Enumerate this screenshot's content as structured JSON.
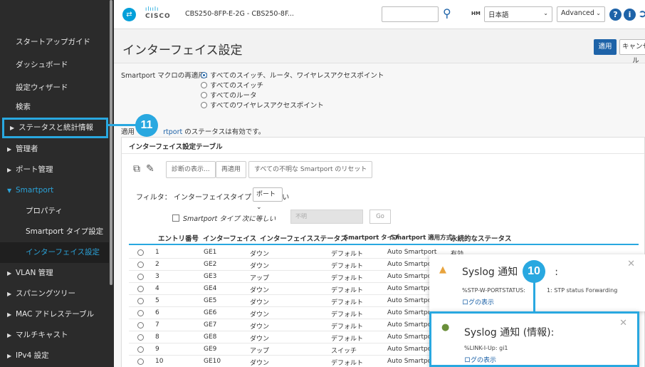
{
  "header": {
    "home_icon": "home-icon",
    "brand_lines": "ılıılı",
    "brand_word": "CISCO",
    "device": "CBS250-8FP-E-2G - CBS250-8F...",
    "hm_label": "HM",
    "language": "日本語",
    "mode": "Advanced"
  },
  "sidebar": {
    "items": [
      {
        "label": "スタートアップガイド"
      },
      {
        "label": "ダッシュボード"
      },
      {
        "label": "設定ウィザード"
      },
      {
        "label": "検索"
      },
      {
        "label": "ステータスと統計情報"
      },
      {
        "label": "管理者"
      },
      {
        "label": "ポート管理"
      },
      {
        "label": "Smartport"
      },
      {
        "label": "プロパティ"
      },
      {
        "label": "Smartport タイプ設定"
      },
      {
        "label": "インターフェイス設定"
      },
      {
        "label": "VLAN 管理"
      },
      {
        "label": "スパニングツリー"
      },
      {
        "label": "MAC アドレステーブル"
      },
      {
        "label": "マルチキャスト"
      },
      {
        "label": "IPv4 設定"
      }
    ]
  },
  "title_bar": {
    "title": "インターフェイス設定",
    "apply": "適用",
    "cancel": "キャンセル"
  },
  "reapply": {
    "label": "Smartport マクロの再適用：",
    "options": [
      "すべてのスイッチ、ルータ、ワイヤレスアクセスポイント",
      "すべてのスイッチ",
      "すべてのルータ",
      "すべてのワイヤレスアクセスポイント"
    ]
  },
  "status": {
    "prefix": "適用",
    "link": "rtport",
    "suffix": " のステータスは有効です。"
  },
  "panel": {
    "title": "インターフェイス設定テーブル",
    "diag": "診断の表示...",
    "reapply": "再適用",
    "reset": "すべての不明な Smartport のリセット",
    "filter_label": "フィルタ：  インターフェイスタイプ  次に等しい",
    "filter_value": "ポート",
    "checkbox_label": "Smartport タイプ  次に等しい",
    "disabled_value": "不明",
    "go": "Go"
  },
  "table": {
    "headers": [
      "エントリ番号",
      "インターフェイス",
      "インターフェイスステータス",
      "Smartport タイプ",
      "Smartport 適用方式",
      "永続的なステータス"
    ],
    "rows": [
      [
        "1",
        "GE1",
        "ダウン",
        "デフォルト",
        "Auto Smartport",
        "有効"
      ],
      [
        "2",
        "GE2",
        "ダウン",
        "デフォルト",
        "Auto Smartpor",
        ""
      ],
      [
        "3",
        "GE3",
        "アップ",
        "デフォルト",
        "Auto Smartpor",
        ""
      ],
      [
        "4",
        "GE4",
        "ダウン",
        "デフォルト",
        "Auto Smartpor",
        ""
      ],
      [
        "5",
        "GE5",
        "ダウン",
        "デフォルト",
        "Auto Smartpor",
        ""
      ],
      [
        "6",
        "GE6",
        "ダウン",
        "デフォルト",
        "Auto Smartpo",
        ""
      ],
      [
        "7",
        "GE7",
        "ダウン",
        "デフォルト",
        "Auto Smartpo",
        ""
      ],
      [
        "8",
        "GE8",
        "ダウン",
        "デフォルト",
        "Auto Smartpo",
        ""
      ],
      [
        "9",
        "GE9",
        "アップ",
        "スイッチ",
        "Auto Smartpo",
        ""
      ],
      [
        "10",
        "GE10",
        "ダウン",
        "デフォルト",
        "Auto Smartpo",
        ""
      ]
    ]
  },
  "notifications": {
    "warning": {
      "title": "Syslog 通知",
      "title_tail": ":",
      "message": "%STP-W-PORTSTATUS:",
      "message_tail": "1: STP status Forwarding",
      "link": "ログの表示"
    },
    "info": {
      "title": "Syslog 通知 (情報):",
      "message": "%LINK-I-Up: gi1",
      "link": "ログの表示"
    }
  },
  "callouts": {
    "status_callout": "11",
    "notification_callout": "10"
  },
  "colors": {
    "accent": "#29a8e0",
    "primary": "#1e63a8",
    "sidebar_bg": "#2b2b2b",
    "warning": "#e8a33d",
    "info": "#6a8f3a"
  }
}
